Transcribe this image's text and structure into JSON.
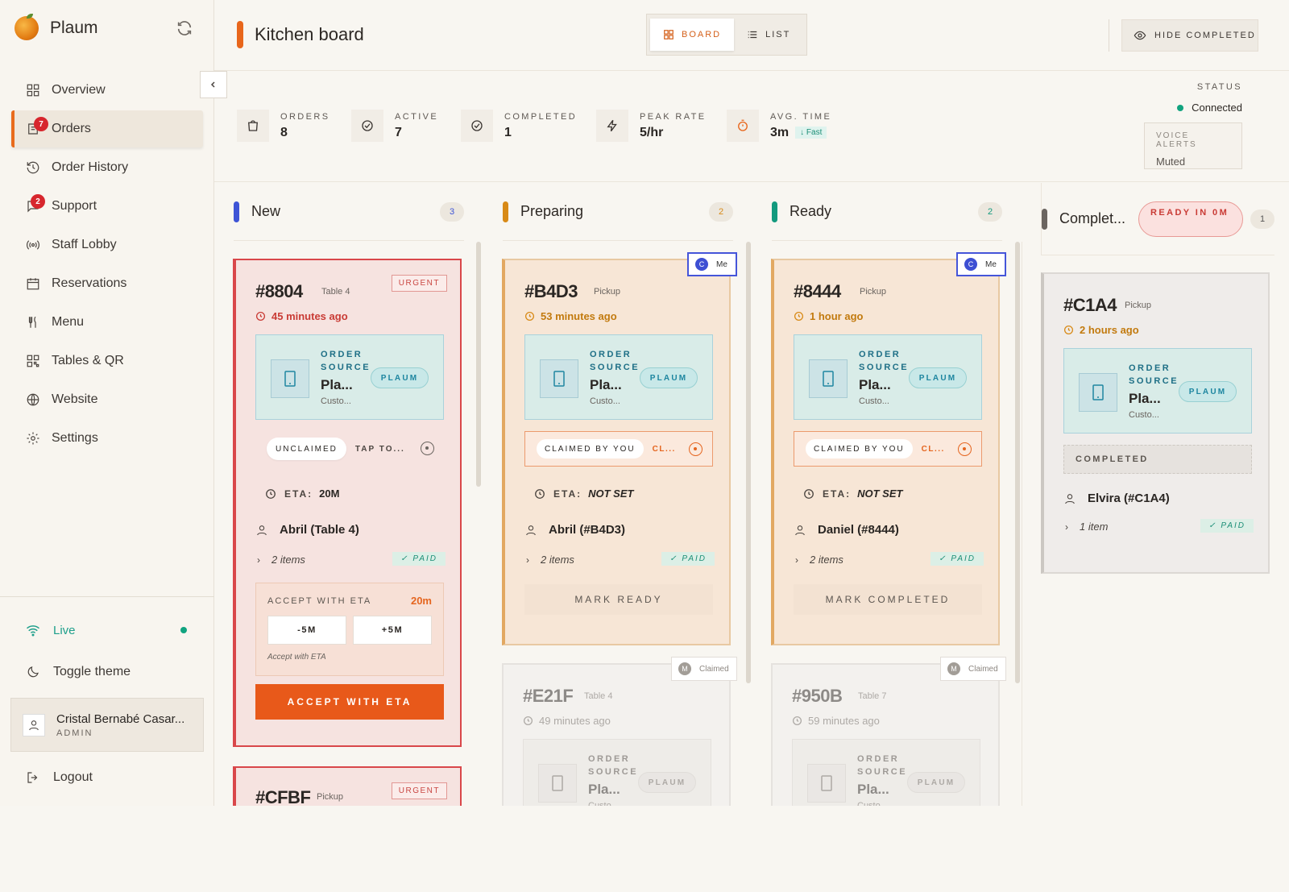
{
  "brand": {
    "name": "Plaum"
  },
  "nav": [
    {
      "label": "Overview",
      "icon": "grid-icon"
    },
    {
      "label": "Orders",
      "icon": "orders-icon",
      "badge": "7"
    },
    {
      "label": "Order History",
      "icon": "history-icon"
    },
    {
      "label": "Support",
      "icon": "chat-icon",
      "badge": "2"
    },
    {
      "label": "Staff Lobby",
      "icon": "broadcast-icon"
    },
    {
      "label": "Reservations",
      "icon": "calendar-icon"
    },
    {
      "label": "Menu",
      "icon": "utensils-icon"
    },
    {
      "label": "Tables & QR",
      "icon": "qr-icon"
    },
    {
      "label": "Website",
      "icon": "globe-icon"
    },
    {
      "label": "Settings",
      "icon": "gear-icon"
    }
  ],
  "live": {
    "label": "Live"
  },
  "theme": {
    "label": "Toggle theme"
  },
  "user": {
    "name": "Cristal Bernabé Casar...",
    "role": "ADMIN"
  },
  "logout": {
    "label": "Logout"
  },
  "topbar": {
    "title": "Kitchen board",
    "board": "BOARD",
    "list": "LIST",
    "hide": "HIDE COMPLETED"
  },
  "stats": [
    {
      "label": "ORDERS",
      "value": "8",
      "icon": "bag-icon"
    },
    {
      "label": "ACTIVE",
      "value": "7",
      "icon": "check-circle-icon"
    },
    {
      "label": "COMPLETED",
      "value": "1",
      "icon": "check-circle-icon"
    },
    {
      "label": "PEAK RATE",
      "value": "5/hr",
      "icon": "bolt-icon"
    },
    {
      "label": "AVG. TIME",
      "value": "3m",
      "icon": "timer-icon",
      "tag": "↓ Fast"
    }
  ],
  "status": {
    "label": "STATUS",
    "value": "Connected",
    "voice_label": "VOICE ALERTS",
    "voice_value": "Muted"
  },
  "columns": [
    {
      "title": "New",
      "count": "3",
      "color": "#3e54d6"
    },
    {
      "title": "Preparing",
      "count": "2",
      "color": "#d88a17"
    },
    {
      "title": "Ready",
      "count": "2",
      "color": "#139a7e"
    },
    {
      "title": "Complet...",
      "count": "1",
      "color": "#6b6560",
      "ready_in": "READY IN 0M"
    }
  ],
  "common": {
    "order_source": "ORDER SOURCE",
    "source_name": "Pla...",
    "source_sub": "Custo...",
    "plaum": "PLAUM",
    "eta_label": "ETA:",
    "paid": "✓ PAID",
    "not_set": "NOT SET",
    "me": "Me",
    "me_initial": "C",
    "claimed": "Claimed",
    "claimed_initial": "M",
    "claimed_by_you": "CLAIMED BY YOU",
    "cl": "CL...",
    "unclaimed": "UNCLAIMED",
    "tap": "TAP TO...",
    "urgent": "URGENT"
  },
  "cards": {
    "c8804": {
      "id": "#8804",
      "sub": "Table 4",
      "time": "45 minutes ago",
      "eta": "20M",
      "customer": "Abril (Table 4)",
      "items": "2 items",
      "accept_label": "ACCEPT WITH ETA",
      "accept_value": "20m",
      "minus": "-5M",
      "plus": "+5M",
      "accept_hint": "Accept with ETA",
      "accept_btn": "ACCEPT WITH ETA"
    },
    "cCFBF": {
      "id": "#CFBF",
      "sub": "Pickup"
    },
    "cB4D3": {
      "id": "#B4D3",
      "sub": "Pickup",
      "time": "53 minutes ago",
      "customer": "Abril (#B4D3)",
      "items": "2 items",
      "action": "MARK READY"
    },
    "cE21F": {
      "id": "#E21F",
      "sub": "Table 4",
      "time": "49 minutes ago"
    },
    "c8444": {
      "id": "#8444",
      "sub": "Pickup",
      "time": "1 hour ago",
      "customer": "Daniel (#8444)",
      "items": "2 items",
      "action": "MARK COMPLETED"
    },
    "c950B": {
      "id": "#950B",
      "sub": "Table 7",
      "time": "59 minutes ago"
    },
    "cC1A4": {
      "id": "#C1A4",
      "sub": "Pickup",
      "time": "2 hours ago",
      "completed": "COMPLETED",
      "customer": "Elvira (#C1A4)",
      "items": "1 item"
    }
  },
  "colors": {
    "accent": "#e8591a",
    "urgent": "#d9474a",
    "teal": "#1e86a0",
    "green": "#11a37f"
  }
}
